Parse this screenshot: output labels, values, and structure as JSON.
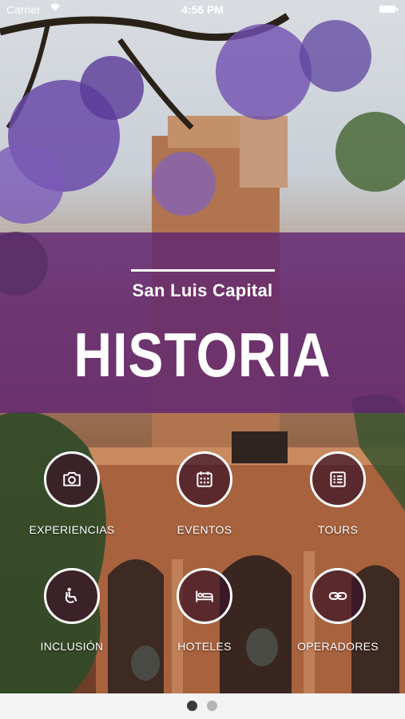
{
  "status_bar": {
    "carrier": "Carrier",
    "time": "4:56 PM"
  },
  "header": {
    "subtitle": "San Luis Capital",
    "title": "HISTORIA"
  },
  "menu": {
    "items": [
      {
        "label": "EXPERIENCIAS",
        "icon": "camera-icon"
      },
      {
        "label": "EVENTOS",
        "icon": "calendar-icon"
      },
      {
        "label": "TOURS",
        "icon": "list-icon"
      },
      {
        "label": "INCLUSIÓN",
        "icon": "accessibility-icon"
      },
      {
        "label": "HOTELES",
        "icon": "bed-icon"
      },
      {
        "label": "OPERADORES",
        "icon": "link-icon"
      }
    ]
  },
  "pagination": {
    "pages": 2,
    "current_page": 1
  },
  "colors": {
    "band_purple": "#602573",
    "icon_circle": "#3c1428",
    "label_text": "#ffffff"
  }
}
